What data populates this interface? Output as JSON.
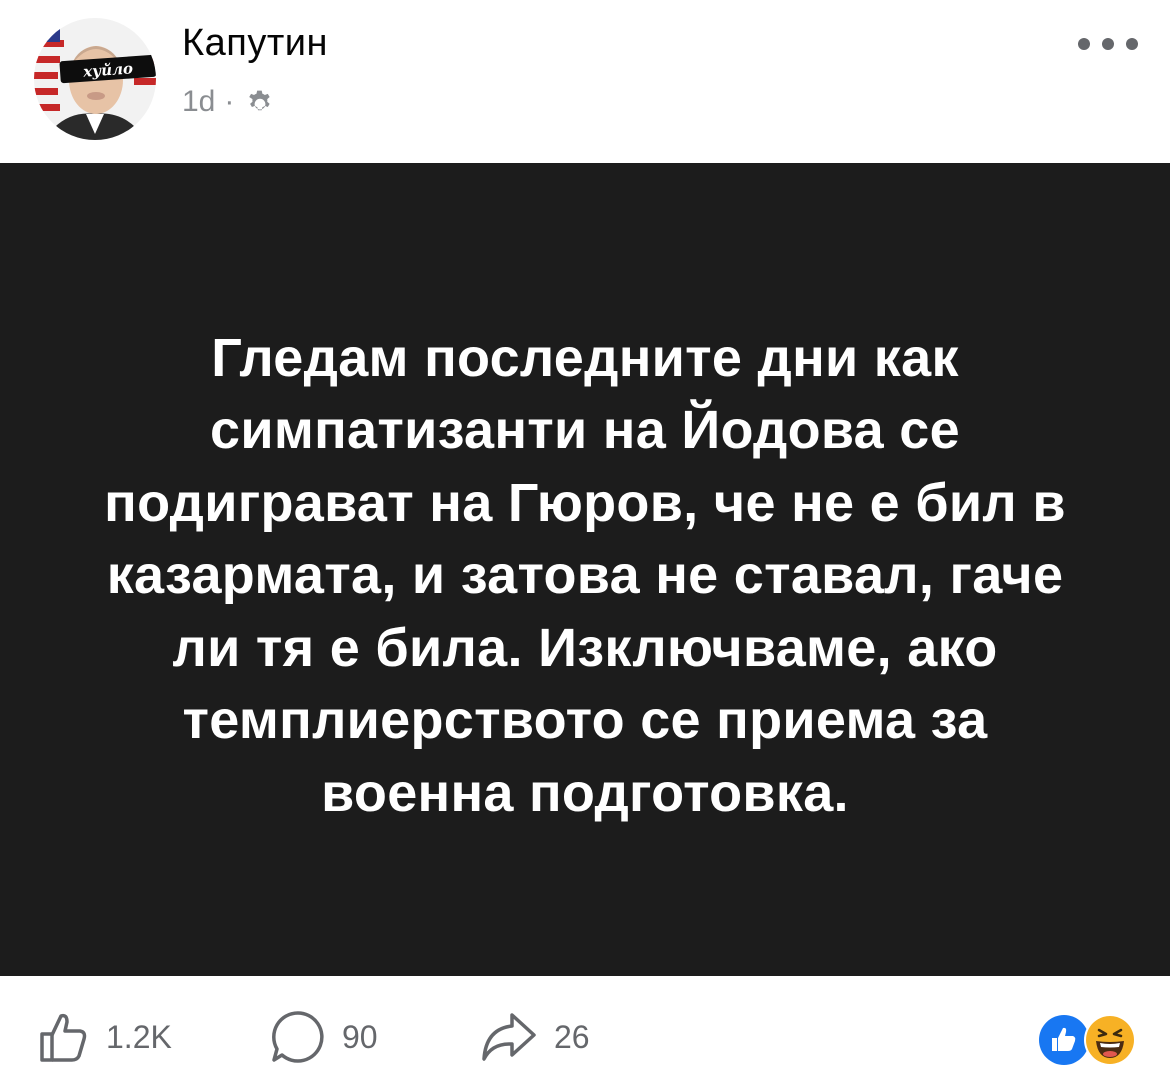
{
  "post": {
    "author": "Капутин",
    "avatar_text": "хуйло",
    "time": "1d",
    "separator": "·",
    "audience_icon": "gear-icon",
    "more_icon": "more-horizontal-icon",
    "card_background": "#1c1c1c",
    "text": "Гледам последните дни как симпатизанти на Йодова се подиграват на Гюров, че не е бил в казармата, и затова не ставал, гаче ли тя е била. Изключваме, ако темплиерството се приема за военна подготовка."
  },
  "actions": {
    "likes": "1.2K",
    "comments": "90",
    "shares": "26",
    "like_icon": "thumbs-up-icon",
    "comment_icon": "comment-bubble-icon",
    "share_icon": "share-arrow-icon"
  },
  "reactions": {
    "icons": [
      "like-reaction-icon",
      "haha-reaction-icon"
    ],
    "like_color": "#1877f2",
    "haha_color": "#f7b125"
  }
}
